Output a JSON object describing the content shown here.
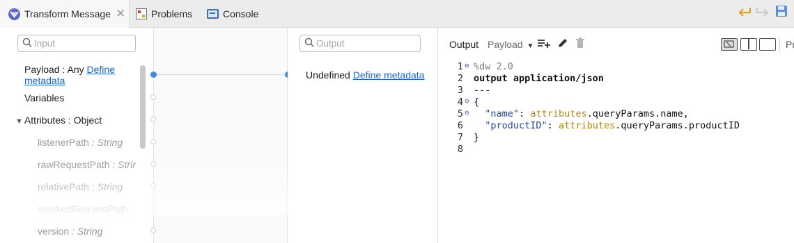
{
  "tabs": [
    {
      "label": "Transform Message",
      "active": true,
      "icon": "dataweave-icon"
    },
    {
      "label": "Problems",
      "active": false,
      "icon": "problems-icon"
    },
    {
      "label": "Console",
      "active": false,
      "icon": "console-icon"
    }
  ],
  "input_panel": {
    "search_placeholder": "Input",
    "items": [
      {
        "prefix": "Payload : Any ",
        "link": "Define",
        "link2": "metadata"
      },
      {
        "label": "Variables"
      },
      {
        "label": "Attributes : Object",
        "expanded": true
      },
      {
        "name": "listenerPath",
        "type": "String"
      },
      {
        "name": "rawRequestPath",
        "type": "Strir"
      },
      {
        "name": "relativePath",
        "type": "String"
      },
      {
        "name": "maskedRequestPath",
        "type": ""
      },
      {
        "name": "version",
        "type": "String"
      }
    ]
  },
  "output_panel": {
    "search_placeholder": "Output",
    "undefined_label": "Undefined",
    "define_link": "Define metadata"
  },
  "editor": {
    "output_label": "Output",
    "payload_label": "Payload",
    "cut_label": "Pr",
    "lines": [
      {
        "n": "1",
        "fold": true,
        "parts": [
          {
            "t": "%dw 2.0",
            "c": "dir"
          }
        ]
      },
      {
        "n": "2",
        "fold": false,
        "parts": [
          {
            "t": "output application/json",
            "c": "kw"
          }
        ]
      },
      {
        "n": "3",
        "fold": false,
        "parts": [
          {
            "t": "---",
            "c": "plain"
          }
        ]
      },
      {
        "n": "4",
        "fold": true,
        "parts": [
          {
            "t": "{",
            "c": "plain"
          }
        ]
      },
      {
        "n": "5",
        "fold": true,
        "parts": [
          {
            "t": "  ",
            "c": "plain"
          },
          {
            "t": "\"name\"",
            "c": "str"
          },
          {
            "t": ": ",
            "c": "plain"
          },
          {
            "t": "attributes",
            "c": "attr"
          },
          {
            "t": ".queryParams.name,",
            "c": "plain"
          }
        ]
      },
      {
        "n": "6",
        "fold": false,
        "parts": [
          {
            "t": "  ",
            "c": "plain"
          },
          {
            "t": "\"productID\"",
            "c": "str"
          },
          {
            "t": ": ",
            "c": "plain"
          },
          {
            "t": "attributes",
            "c": "attr"
          },
          {
            "t": ".queryParams.productID",
            "c": "plain"
          }
        ]
      },
      {
        "n": "7",
        "fold": false,
        "parts": [
          {
            "t": "}",
            "c": "plain"
          }
        ]
      },
      {
        "n": "8",
        "fold": false,
        "parts": []
      }
    ]
  },
  "colors": {
    "link": "#1a63d8",
    "connector_dot": "#3a90e8",
    "dataweave_icon": "#5b66d6",
    "attributes_token": "#b8860b",
    "string_token": "#2244b0"
  }
}
